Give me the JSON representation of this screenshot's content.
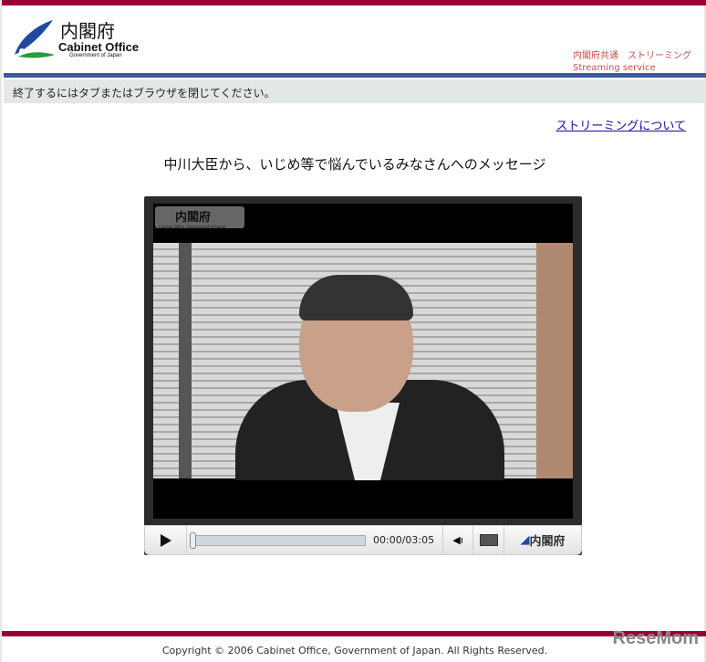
{
  "header": {
    "logo_jp": "内閣府",
    "logo_en": "Cabinet Office",
    "logo_sub": "Government of Japan",
    "service_jp": "内閣府共通　ストリーミング",
    "service_en": "Streaming service"
  },
  "notice": "終了するにはタブまたはブラウザを閉じてください。",
  "about_link": "ストリーミングについて",
  "video_title": "中川大臣から、いじめ等で悩んでいるみなさんへのメッセージ",
  "player": {
    "watermark_jp": "内閣府",
    "watermark_en": "Cabinet Office, Government of Japan",
    "current_time": "00:00",
    "duration": "03:05",
    "time_display": "00:00/03:05",
    "progress": 0,
    "brand": "内閣府"
  },
  "footer": {
    "copyright": "Copyright © 2006 Cabinet Office, Government of Japan. All Rights Reserved.",
    "watermark": "ReseMom"
  }
}
